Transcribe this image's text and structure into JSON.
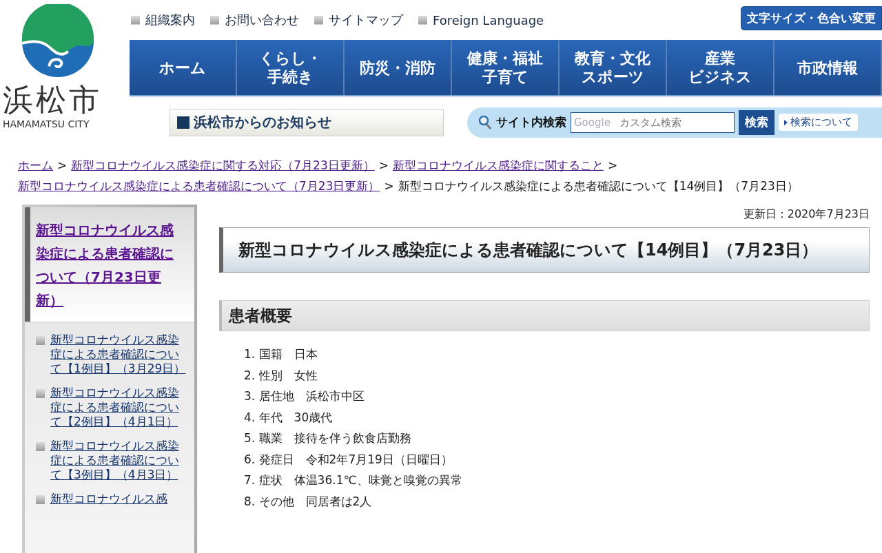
{
  "logo": {
    "name": "浜松市",
    "subtitle": "HAMAMATSU CITY"
  },
  "top_links": [
    "組織案内",
    "お問い合わせ",
    "サイトマップ",
    "Foreign Language"
  ],
  "accessibility_button": "文字サイズ・色合い変更",
  "nav": [
    {
      "lines": [
        "ホーム"
      ]
    },
    {
      "lines": [
        "くらし・",
        "手続き"
      ]
    },
    {
      "lines": [
        "防災・消防"
      ]
    },
    {
      "lines": [
        "健康・福祉",
        "子育て"
      ]
    },
    {
      "lines": [
        "教育・文化",
        "スポーツ"
      ]
    },
    {
      "lines": [
        "産業",
        "ビジネス"
      ]
    },
    {
      "lines": [
        "市政情報"
      ]
    }
  ],
  "notice_link": "浜松市からのお知らせ",
  "search": {
    "label": "サイト内検索",
    "brand": "Google",
    "placeholder": "カスタム検索",
    "button": "検索",
    "help": "検索について"
  },
  "breadcrumbs": [
    {
      "kind": "link",
      "text": "ホーム"
    },
    {
      "kind": "link",
      "sep": ">",
      "text": "新型コロナウイルス感染症に関する対応（7月23日更新）"
    },
    {
      "kind": "link",
      "sep": ">",
      "text": "新型コロナウイルス感染症に関すること"
    },
    {
      "kind": "link",
      "sep": ">",
      "text": "新型コロナウイルス感染症による患者確認について（7月23日更新）"
    },
    {
      "kind": "current",
      "sep": ">",
      "text": "新型コロナウイルス感染症による患者確認について【14例目】（7月23日）"
    }
  ],
  "sidebar": {
    "title": "新型コロナウイルス感染症による患者確認について（7月23日更新）",
    "items": [
      "新型コロナウイルス感染症による患者確認について【1例目】（3月29日）",
      "新型コロナウイルス感染症による患者確認について【2例目】（4月1日）",
      "新型コロナウイルス感染症による患者確認について【3例目】（4月3日）",
      "新型コロナウイルス感"
    ]
  },
  "updated": "更新日：2020年7月23日",
  "page_title": "新型コロナウイルス感染症による患者確認について【14例目】（7月23日）",
  "section_heading": "患者概要",
  "summary": [
    {
      "number": "1.",
      "label": "国籍",
      "value": "日本"
    },
    {
      "number": "2.",
      "label": "性別",
      "value": "女性"
    },
    {
      "number": "3.",
      "label": "居住地",
      "value": "浜松市中区"
    },
    {
      "number": "4.",
      "label": "年代",
      "value": "30歳代"
    },
    {
      "number": "5.",
      "label": "職業",
      "value": "接待を伴う飲食店勤務"
    },
    {
      "number": "6.",
      "label": "発症日",
      "value": "令和2年7月19日（日曜日）"
    },
    {
      "number": "7.",
      "label": "症状",
      "value": "体温36.1℃、味覚と嗅覚の異常"
    },
    {
      "number": "8.",
      "label": "その他",
      "value": "同居者は2人"
    }
  ]
}
